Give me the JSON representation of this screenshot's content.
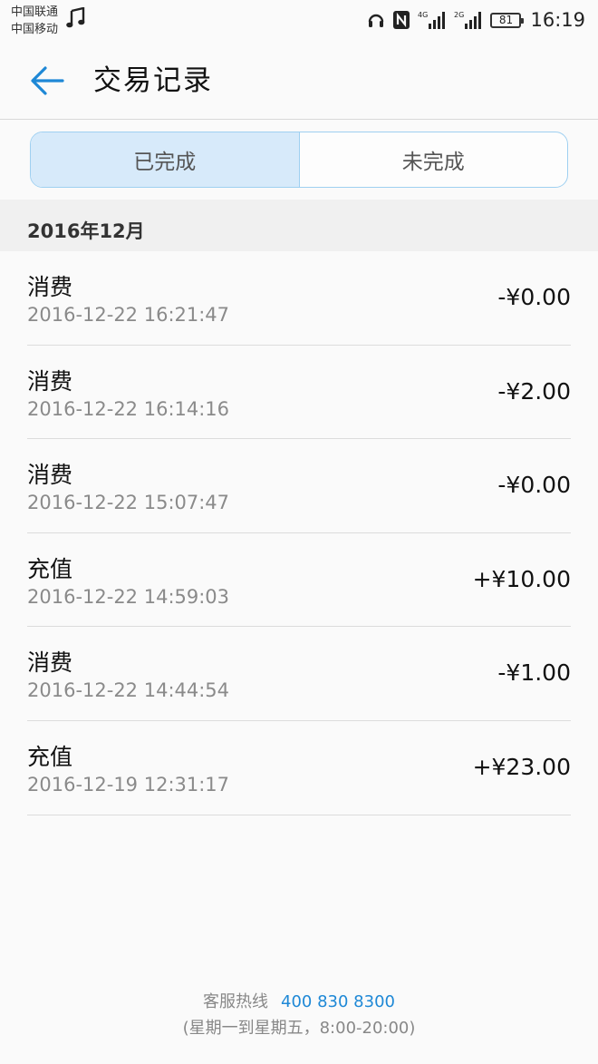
{
  "status_bar": {
    "carrier_1": "中国联通",
    "carrier_2": "中国移动",
    "network_1": "4G",
    "network_2": "2G",
    "battery": "81",
    "time": "16:19",
    "icons": [
      "music-icon",
      "headphones-icon",
      "nfc-icon",
      "signal-icon",
      "battery-icon"
    ]
  },
  "header": {
    "title": "交易记录",
    "back_icon": "arrow-left-icon"
  },
  "tabs": [
    {
      "label": "已完成",
      "active": true
    },
    {
      "label": "未完成",
      "active": false
    }
  ],
  "month": "2016年12月",
  "transactions": [
    {
      "type": "消费",
      "time": "2016-12-22 16:21:47",
      "amount": "-¥0.00"
    },
    {
      "type": "消费",
      "time": "2016-12-22 16:14:16",
      "amount": "-¥2.00"
    },
    {
      "type": "消费",
      "time": "2016-12-22 15:07:47",
      "amount": "-¥0.00"
    },
    {
      "type": "充值",
      "time": "2016-12-22 14:59:03",
      "amount": "+¥10.00"
    },
    {
      "type": "消费",
      "time": "2016-12-22 14:44:54",
      "amount": "-¥1.00"
    },
    {
      "type": "充值",
      "time": "2016-12-19 12:31:17",
      "amount": "+¥23.00"
    }
  ],
  "footer": {
    "hotline_label": "客服热线",
    "hotline_number": "400 830 8300",
    "hours": "(星期一到星期五，8:00-20:00)"
  },
  "colors": {
    "accent": "#1e88d6",
    "tab_active_bg": "#d7eafa",
    "tab_border": "#9fd0f1"
  }
}
